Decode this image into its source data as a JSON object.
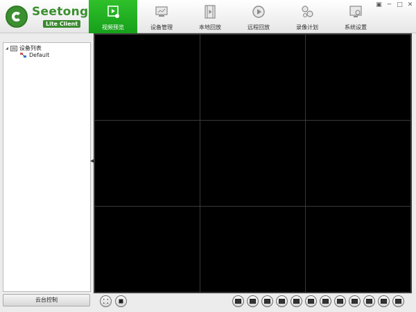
{
  "brand": {
    "name": "Seetong",
    "subtitle": "Lite Client"
  },
  "tabs": [
    {
      "label": "视频预览",
      "icon": "video-preview-icon",
      "active": true
    },
    {
      "label": "设备管理",
      "icon": "device-manage-icon",
      "active": false
    },
    {
      "label": "本地回放",
      "icon": "local-playback-icon",
      "active": false
    },
    {
      "label": "远程回放",
      "icon": "remote-playback-icon",
      "active": false
    },
    {
      "label": "录像计划",
      "icon": "record-plan-icon",
      "active": false
    },
    {
      "label": "系统设置",
      "icon": "system-settings-icon",
      "active": false
    }
  ],
  "window": {
    "minimize": "─",
    "maximize": "□",
    "close": "✕",
    "pin": "▣"
  },
  "tree": {
    "root_label": "设备列表",
    "expander": "◢",
    "children": [
      {
        "label": "Default"
      }
    ]
  },
  "ptz_button": "云台控制",
  "colors": {
    "accent": "#1fae1f",
    "brand": "#3b8f2f",
    "video_bg": "#000000",
    "grid_line": "#3a3a3a"
  },
  "grid": {
    "rows": 3,
    "cols": 3
  },
  "layout_buttons": [
    "layout-1",
    "layout-4",
    "layout-6",
    "layout-8",
    "layout-9",
    "layout-10",
    "layout-13",
    "layout-16",
    "layout-20",
    "layout-25",
    "layout-36",
    "layout-64"
  ]
}
